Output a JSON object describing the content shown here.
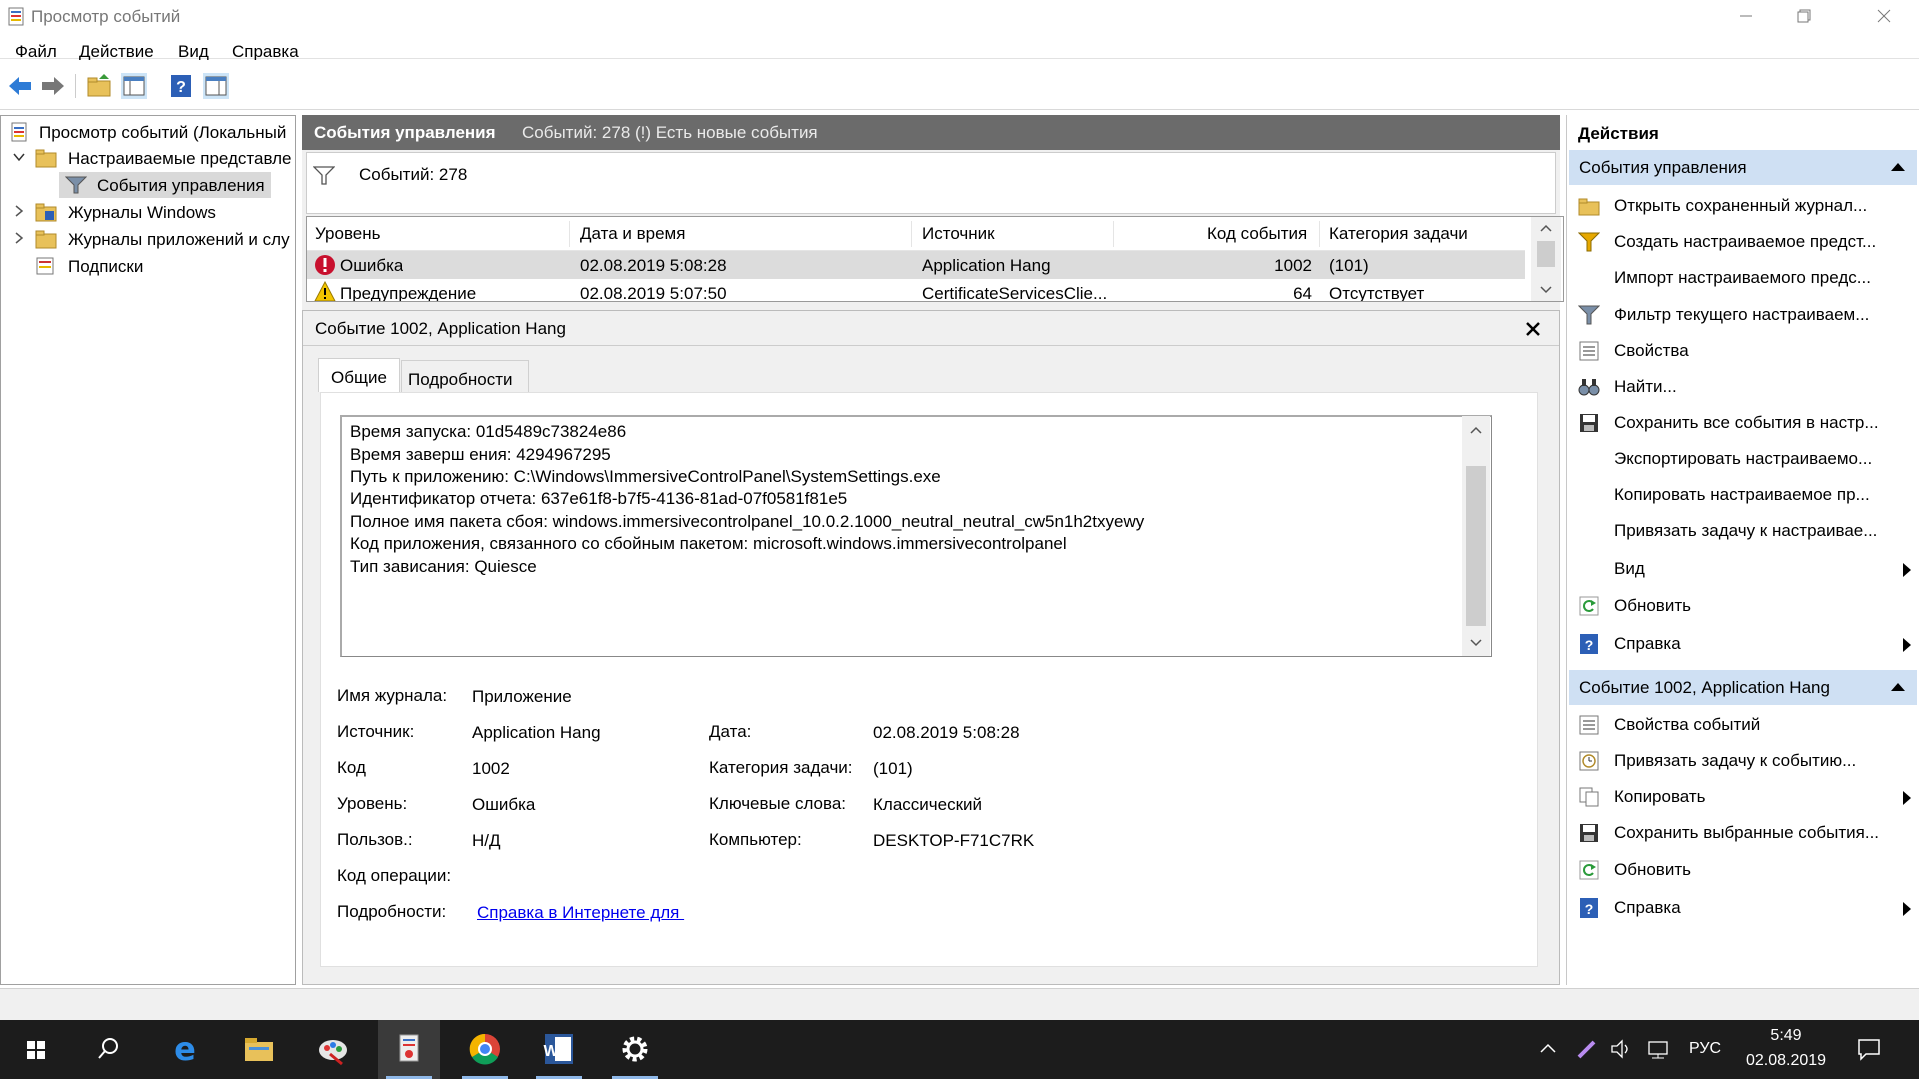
{
  "window": {
    "title": "Просмотр событий"
  },
  "menu": [
    "Файл",
    "Действие",
    "Вид",
    "Справка"
  ],
  "toolbar_icons": [
    "back-arrow-icon",
    "forward-arrow-icon",
    "folder-up-icon",
    "show-hide-tree-icon",
    "help-icon",
    "show-hide-actions-icon"
  ],
  "tree": {
    "root": "Просмотр событий (Локальный",
    "custom_views": "Настраиваемые представле",
    "admin_events": "События управления",
    "windows_logs": "Журналы Windows",
    "app_logs": "Журналы приложений и слу",
    "subscriptions": "Подписки"
  },
  "events_panel": {
    "title": "События управления",
    "summary": "Событий: 278 (!) Есть новые события",
    "filter_count": "Событий: 278"
  },
  "grid": {
    "columns": [
      "Уровень",
      "Дата и время",
      "Источник",
      "Код события",
      "Категория задачи"
    ],
    "rows": [
      {
        "level": "Ошибка",
        "datetime": "02.08.2019 5:08:28",
        "source": "Application Hang",
        "code": "1002",
        "category": "(101)"
      },
      {
        "level": "Предупреждение",
        "datetime": "02.08.2019 5:07:50",
        "source": "CertificateServicesClie...",
        "code": "64",
        "category": "Отсутствует"
      }
    ]
  },
  "detail": {
    "title": "Событие 1002, Application Hang",
    "tabs": [
      "Общие",
      "Подробности"
    ],
    "description": [
      "Время запуска: 01d5489c73824e86",
      "Время заверш ения: 4294967295",
      "Путь к приложению: C:\\Windows\\ImmersiveControlPanel\\SystemSettings.exe",
      "Идентификатор отчета: 637e61f8-b7f5-4136-81ad-07f0581f81e5",
      "Полное имя пакета сбоя: windows.immersivecontrolpanel_10.0.2.1000_neutral_neutral_cw5n1h2txyewy",
      "Код приложения, связанного со сбойным пакетом: microsoft.windows.immersivecontrolpanel",
      "Тип зависания: Quiesce"
    ],
    "props": {
      "log_name_label": "Имя журнала:",
      "log_name": "Приложение",
      "source_label": "Источник:",
      "source": "Application Hang",
      "date_label": "Дата:",
      "date": "02.08.2019 5:08:28",
      "code_label": "Код",
      "code": "1002",
      "task_label": "Категория задачи:",
      "task": "(101)",
      "level_label": "Уровень:",
      "level": "Ошибка",
      "keywords_label": "Ключевые слова:",
      "keywords": "Классический",
      "user_label": "Пользов.:",
      "user": "Н/Д",
      "computer_label": "Компьютер:",
      "computer": "DESKTOP-F71C7RK",
      "opcode_label": "Код операции:",
      "more_label": "Подробности:",
      "more_link": "Справка в Интернете для "
    }
  },
  "actions": {
    "header": "Действия",
    "section1": "События управления",
    "items1": [
      {
        "label": "Открыть сохраненный журнал...",
        "icon": "open-log-icon"
      },
      {
        "label": "Создать настраиваемое предст...",
        "icon": "create-view-icon"
      },
      {
        "label": "Импорт настраиваемого предс...",
        "icon": ""
      },
      {
        "label": "Фильтр текущего настраиваем...",
        "icon": "filter-icon"
      },
      {
        "label": "Свойства",
        "icon": "properties-icon"
      },
      {
        "label": "Найти...",
        "icon": "find-binoculars-icon"
      },
      {
        "label": "Сохранить все события в настр...",
        "icon": "save-icon"
      },
      {
        "label": "Экспортировать настраиваемо...",
        "icon": ""
      },
      {
        "label": "Копировать настраиваемое пр...",
        "icon": ""
      },
      {
        "label": "Привязать задачу к настраивае...",
        "icon": ""
      },
      {
        "label": "Вид",
        "icon": "",
        "submenu": true
      },
      {
        "label": "Обновить",
        "icon": "refresh-icon"
      },
      {
        "label": "Справка",
        "icon": "help-icon",
        "submenu": true
      }
    ],
    "section2": "Событие 1002, Application Hang",
    "items2": [
      {
        "label": "Свойства событий",
        "icon": "event-properties-icon"
      },
      {
        "label": "Привязать задачу к событию...",
        "icon": "attach-task-icon"
      },
      {
        "label": "Копировать",
        "icon": "copy-icon",
        "submenu": true
      },
      {
        "label": "Сохранить выбранные события...",
        "icon": "save-icon"
      },
      {
        "label": "Обновить",
        "icon": "refresh-icon"
      },
      {
        "label": "Справка",
        "icon": "help-icon",
        "submenu": true
      }
    ]
  },
  "taskbar": {
    "lang": "РУС",
    "time": "5:49",
    "date": "02.08.2019"
  },
  "colors": {
    "accent": "#cfe0f3",
    "header_gray": "#6b6b6b",
    "link": "#0000ee",
    "taskbar": "#1c1c1c"
  }
}
